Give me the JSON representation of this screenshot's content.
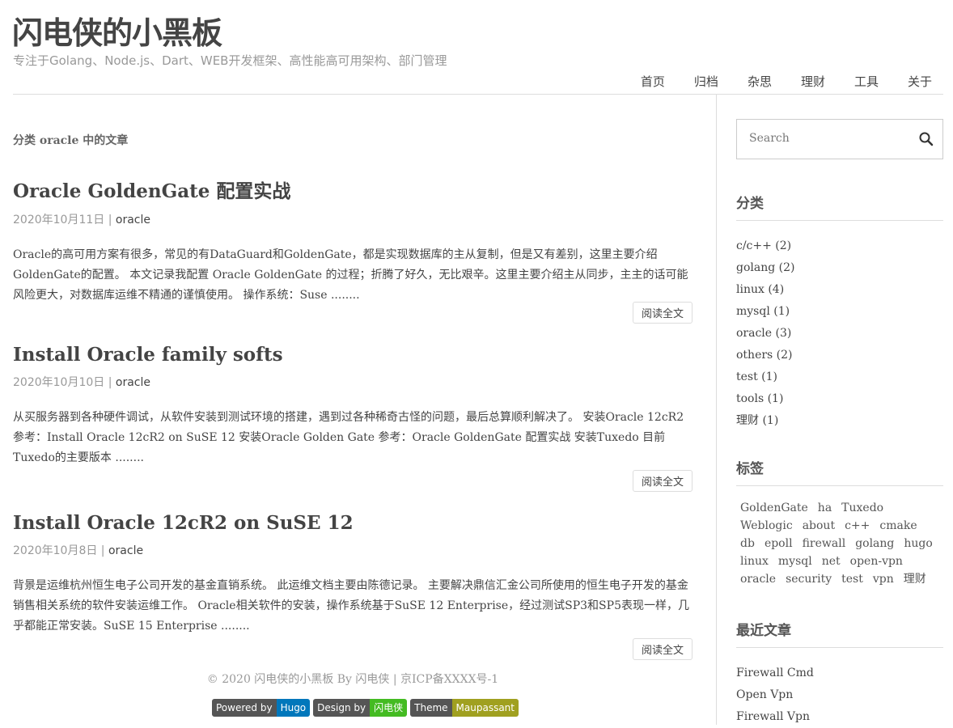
{
  "site": {
    "title": "闪电侠的小黑板",
    "description": "专注于Golang、Node.js、Dart、WEB开发框架、高性能高可用架构、部门管理"
  },
  "nav": [
    "首页",
    "归档",
    "杂思",
    "理财",
    "工具",
    "关于"
  ],
  "page_heading": "分类 oracle 中的文章",
  "posts": [
    {
      "title": "Oracle GoldenGate 配置实战",
      "date": "2020年10月11日",
      "category": "oracle",
      "excerpt": "Oracle的高可用方案有很多，常见的有DataGuard和GoldenGate，都是实现数据库的主从复制，但是又有差别，这里主要介绍GoldenGate的配置。 本文记录我配置 Oracle GoldenGate 的过程；折腾了好久，无比艰辛。这里主要介绍主从同步，主主的话可能风险更大，对数据库运维不精通的谨慎使用。 操作系统：Suse ........",
      "read_more": "阅读全文"
    },
    {
      "title": "Install Oracle family softs",
      "date": "2020年10月10日",
      "category": "oracle",
      "excerpt": "从买服务器到各种硬件调试，从软件安装到测试环境的搭建，遇到过各种稀奇古怪的问题，最后总算顺利解决了。 安装Oracle 12cR2 参考：Install Oracle 12cR2 on SuSE 12 安装Oracle Golden Gate 参考：Oracle GoldenGate 配置实战 安装Tuxedo 目前Tuxedo的主要版本 ........",
      "read_more": "阅读全文"
    },
    {
      "title": "Install Oracle 12cR2 on SuSE 12",
      "date": "2020年10月8日",
      "category": "oracle",
      "excerpt": "背景是运维杭州恒生电子公司开发的基金直销系统。 此运维文档主要由陈德记录。 主要解决鼎信汇金公司所使用的恒生电子开发的基金销售相关系统的软件安装运维工作。 Oracle相关软件的安装，操作系统基于SuSE 12 Enterprise，经过测试SP3和SP5表现一样，几乎都能正常安装。SuSE 15 Enterprise ........",
      "read_more": "阅读全文"
    }
  ],
  "footer": {
    "text": "© 2020 闪电侠的小黑板 By 闪电侠 | 京ICP备XXXX号-1",
    "badges": [
      {
        "left": "Powered by",
        "right": "Hugo",
        "color": "#0077bb"
      },
      {
        "left": "Design by",
        "right": "闪电侠",
        "color": "#44bb22"
      },
      {
        "left": "Theme",
        "right": "Maupassant",
        "color": "#a0a020"
      }
    ]
  },
  "sidebar": {
    "search_placeholder": "Search",
    "categories_title": "分类",
    "categories": [
      "c/c++ (2)",
      "golang (2)",
      "linux (4)",
      "mysql (1)",
      "oracle (3)",
      "others (2)",
      "test (1)",
      "tools (1)",
      "理财 (1)"
    ],
    "tags_title": "标签",
    "tags": [
      "GoldenGate",
      "ha",
      "Tuxedo",
      "Weblogic",
      "about",
      "c++",
      "cmake",
      "db",
      "epoll",
      "firewall",
      "golang",
      "hugo",
      "linux",
      "mysql",
      "net",
      "open-vpn",
      "oracle",
      "security",
      "test",
      "vpn",
      "理财"
    ],
    "recent_title": "最近文章",
    "recent": [
      "Firewall Cmd",
      "Open Vpn",
      "Firewall Vpn"
    ]
  }
}
